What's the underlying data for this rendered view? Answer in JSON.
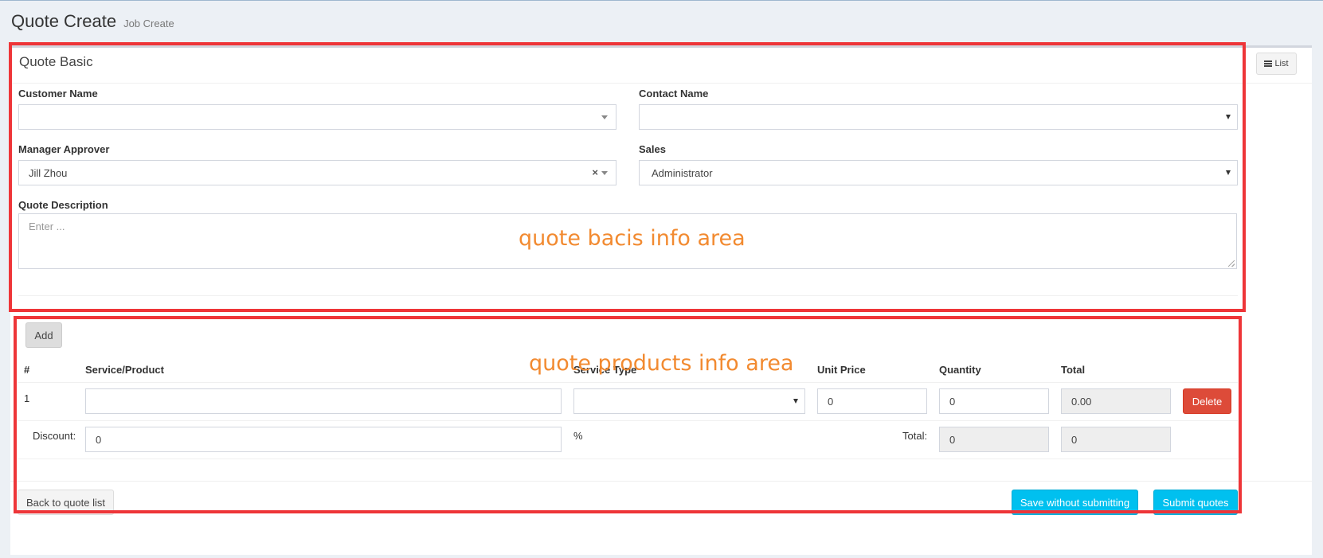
{
  "header": {
    "title": "Quote Create",
    "subtitle": "Job Create"
  },
  "basic": {
    "title": "Quote Basic",
    "list_button": "List",
    "customer_name": {
      "label": "Customer Name",
      "value": ""
    },
    "contact_name": {
      "label": "Contact Name",
      "value": ""
    },
    "manager_approver": {
      "label": "Manager Approver",
      "value": "Jill Zhou",
      "clear": "×"
    },
    "sales": {
      "label": "Sales",
      "value": "Administrator"
    },
    "description": {
      "label": "Quote Description",
      "placeholder": "Enter ..."
    }
  },
  "products": {
    "add_button": "Add",
    "columns": [
      "#",
      "Service/Product",
      "Service Type",
      "Unit Price",
      "Quantity",
      "Total"
    ],
    "rows": [
      {
        "index": "1",
        "service_product": "",
        "service_type": "",
        "unit_price": "0",
        "quantity": "0",
        "total": "0.00",
        "delete_label": "Delete"
      }
    ],
    "discount": {
      "label": "Discount:",
      "value": "0",
      "unit": "%"
    },
    "totals": {
      "label": "Total:",
      "quantity_total": "0",
      "amount_total": "0"
    }
  },
  "footer": {
    "back_button": "Back to quote list",
    "save_button": "Save without submitting",
    "submit_button": "Submit quotes"
  },
  "annotations": {
    "basic_area": "quote bacis info area",
    "products_area": "quote products info area",
    "color": "#ee3538",
    "text_color": "#f28a30"
  }
}
